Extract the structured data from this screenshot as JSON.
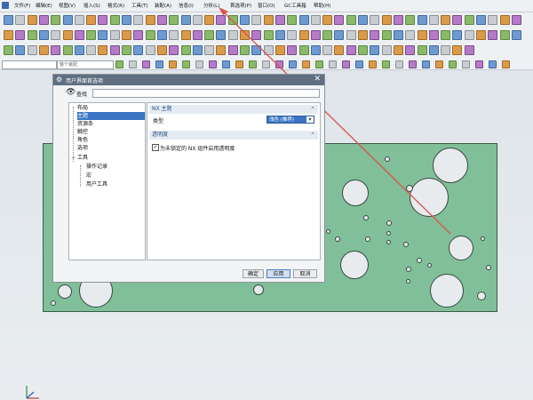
{
  "menu": [
    "文件(F)",
    "编辑(E)",
    "视图(V)",
    "插入(S)",
    "格式(R)",
    "工具(T)",
    "装配(A)",
    "信息(I)",
    "分析(L)",
    "首选项(P)",
    "窗口(O)",
    "GC工具箱",
    "帮助(H)"
  ],
  "toolbar": {
    "selection_filter": "",
    "assembly_scope": "整个装配"
  },
  "dialog": {
    "title": "用户界面首选项",
    "find_label": "查找",
    "find_value": "",
    "tree": [
      "布局",
      "主题",
      "资源条",
      "触控",
      "角色",
      "选项",
      "工具",
      "操作记录",
      "宏",
      "用户工具"
    ],
    "selected_index": 1,
    "section1": {
      "title": "NX 主题",
      "type_label": "类型",
      "type_value": "浅色 (推荐)"
    },
    "section2": {
      "title": "透明度",
      "checkbox_label": "为未锁定的 NX 组件启用透明度",
      "checked": true
    },
    "buttons": {
      "ok": "确定",
      "apply": "应用",
      "cancel": "取消"
    }
  },
  "colors": {
    "plate": "#80bf99",
    "selection": "#3a75c4",
    "annotation_arrow": "#d9534f"
  }
}
